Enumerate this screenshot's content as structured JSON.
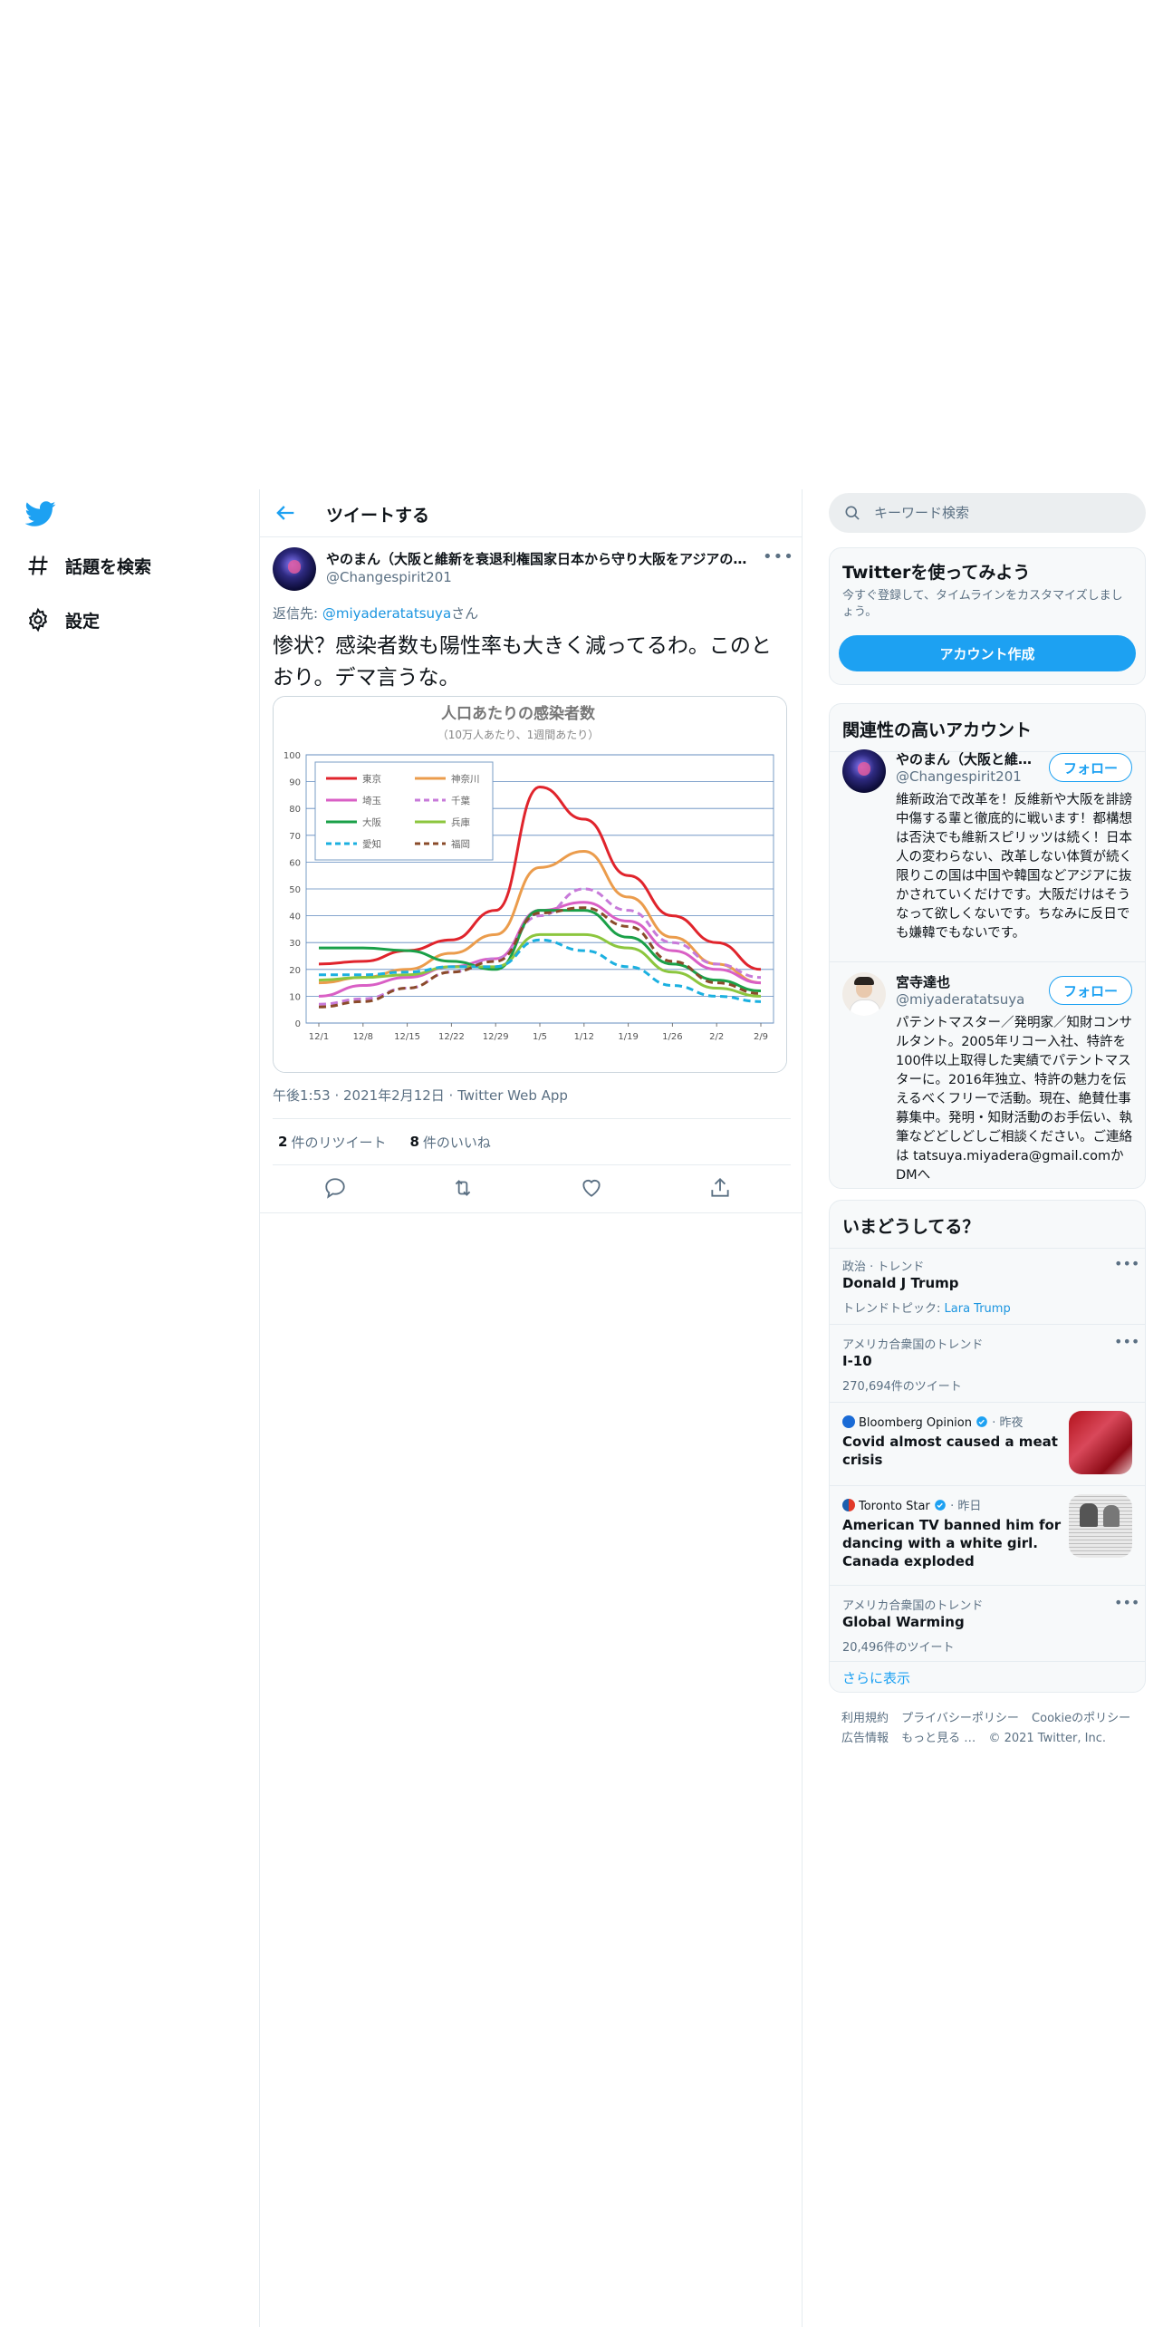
{
  "nav": {
    "logo": "twitter-bird-icon",
    "items": [
      {
        "label": "話題を検索",
        "icon": "hashtag-icon"
      },
      {
        "label": "設定",
        "icon": "gear-icon"
      }
    ]
  },
  "main": {
    "header_title": "ツイートする",
    "tweet": {
      "author_name": "やのまん（大阪と維新を衰退利権国家日本から守り大阪をアジアの…",
      "author_handle": "@Changespirit201",
      "reply_prefix": "返信先: ",
      "reply_user": "@miyaderatatsuya",
      "reply_suffix": "さん",
      "text": "惨状？感染者数も陽性率も大きく減ってるわ。このとおり。デマ言うな。",
      "timestamp": "午後1:53 · 2021年2月12日 · Twitter Web App",
      "retweets": "2",
      "retweets_label": "件のリツイート",
      "likes": "8",
      "likes_label": "件のいいね"
    }
  },
  "chart_data": {
    "type": "line",
    "title": "人口あたりの感染者数",
    "subtitle": "（10万人あたり、1週間あたり）",
    "x": [
      "12/1",
      "12/8",
      "12/15",
      "12/22",
      "12/29",
      "1/5",
      "1/12",
      "1/19",
      "1/26",
      "2/2",
      "2/9"
    ],
    "y_ticks": [
      "0",
      "10",
      "20",
      "30",
      "40",
      "50",
      "60",
      "70",
      "80",
      "90",
      "100"
    ],
    "ylim": [
      0,
      100
    ],
    "grid": true,
    "legend_position": "top-left",
    "series": [
      {
        "name": "東京",
        "color": "#e0242c",
        "dash": "solid",
        "values": [
          22,
          23,
          27,
          31,
          42,
          88,
          76,
          55,
          40,
          30,
          20
        ]
      },
      {
        "name": "神奈川",
        "color": "#eb9c4c",
        "dash": "solid",
        "values": [
          15,
          17,
          20,
          26,
          33,
          58,
          64,
          47,
          32,
          22,
          15
        ]
      },
      {
        "name": "埼玉",
        "color": "#d95fc5",
        "dash": "solid",
        "values": [
          10,
          14,
          17,
          21,
          24,
          42,
          45,
          38,
          27,
          20,
          15
        ]
      },
      {
        "name": "千葉",
        "color": "#c77ad9",
        "dash": "dashed",
        "values": [
          7,
          9,
          13,
          19,
          24,
          40,
          50,
          42,
          30,
          22,
          17
        ]
      },
      {
        "name": "大阪",
        "color": "#1aa048",
        "dash": "solid",
        "values": [
          28,
          28,
          27,
          23,
          20,
          42,
          42,
          32,
          22,
          16,
          12
        ]
      },
      {
        "name": "兵庫",
        "color": "#8cc63e",
        "dash": "solid",
        "values": [
          16,
          17,
          18,
          21,
          21,
          33,
          33,
          28,
          19,
          13,
          10
        ]
      },
      {
        "name": "愛知",
        "color": "#1bb0e0",
        "dash": "dashed",
        "values": [
          18,
          18,
          19,
          21,
          21,
          31,
          27,
          21,
          14,
          10,
          8
        ]
      },
      {
        "name": "福岡",
        "color": "#8a4b2a",
        "dash": "dashed",
        "values": [
          6,
          8,
          13,
          19,
          23,
          41,
          43,
          36,
          23,
          15,
          11
        ]
      }
    ]
  },
  "sidebar": {
    "search_placeholder": "キーワード検索",
    "signup": {
      "title": "Twitterを使ってみよう",
      "desc": "今すぐ登録して、タイムラインをカスタマイズしましょう。",
      "button": "アカウント作成"
    },
    "related": {
      "title": "関連性の高いアカウント",
      "accounts": [
        {
          "name": "やのまん（大阪と維…",
          "handle": "@Changespirit201",
          "bio": "維新政治で改革を！反維新や大阪を誹謗中傷する輩と徹底的に戦います！都構想は否決でも維新スピリッツは続く！日本人の変わらない、改革しない体質が続く限りこの国は中国や韓国などアジアに抜かされていくだけです。大阪だけはそうなって欲しくないです。ちなみに反日でも嫌韓でもないです。",
          "follow": "フォロー"
        },
        {
          "name": "宮寺達也",
          "handle": "@miyaderatatsuya",
          "bio": "パテントマスター／発明家／知財コンサルタント。2005年リコー入社、特許を100件以上取得した実績でパテントマスターに。2016年独立、特許の魅力を伝えるべくフリーで活動。現在、絶賛仕事募集中。発明・知財活動のお手伝い、執筆などどしどしご相談ください。ご連絡は tatsuya.miyadera@gmail.comかDMへ",
          "follow": "フォロー"
        }
      ]
    },
    "trends": {
      "title": "いまどうしてる？",
      "items": [
        {
          "meta": "政治 · トレンド",
          "title": "Donald J Trump",
          "sub_prefix": "トレンドトピック: ",
          "sub_link": "Lara Trump"
        },
        {
          "meta": "アメリカ合衆国のトレンド",
          "title": "I-10",
          "sub": "270,694件のツイート"
        },
        {
          "source": "Bloomberg Opinion",
          "when": "· 昨夜",
          "title": "Covid almost caused a meat crisis",
          "thumb": "meat-photo"
        },
        {
          "source": "Toronto Star",
          "when": "· 昨日",
          "title": "American TV banned him for dancing with a white girl. Canada exploded",
          "thumb": "newspaper-photo"
        },
        {
          "meta": "アメリカ合衆国のトレンド",
          "title": "Global Warming",
          "sub": "20,496件のツイート"
        }
      ],
      "show_more": "さらに表示"
    },
    "footer": [
      "利用規約",
      "プライバシーポリシー",
      "Cookieのポリシー",
      "広告情報",
      "もっと見る …",
      "© 2021 Twitter, Inc."
    ]
  }
}
